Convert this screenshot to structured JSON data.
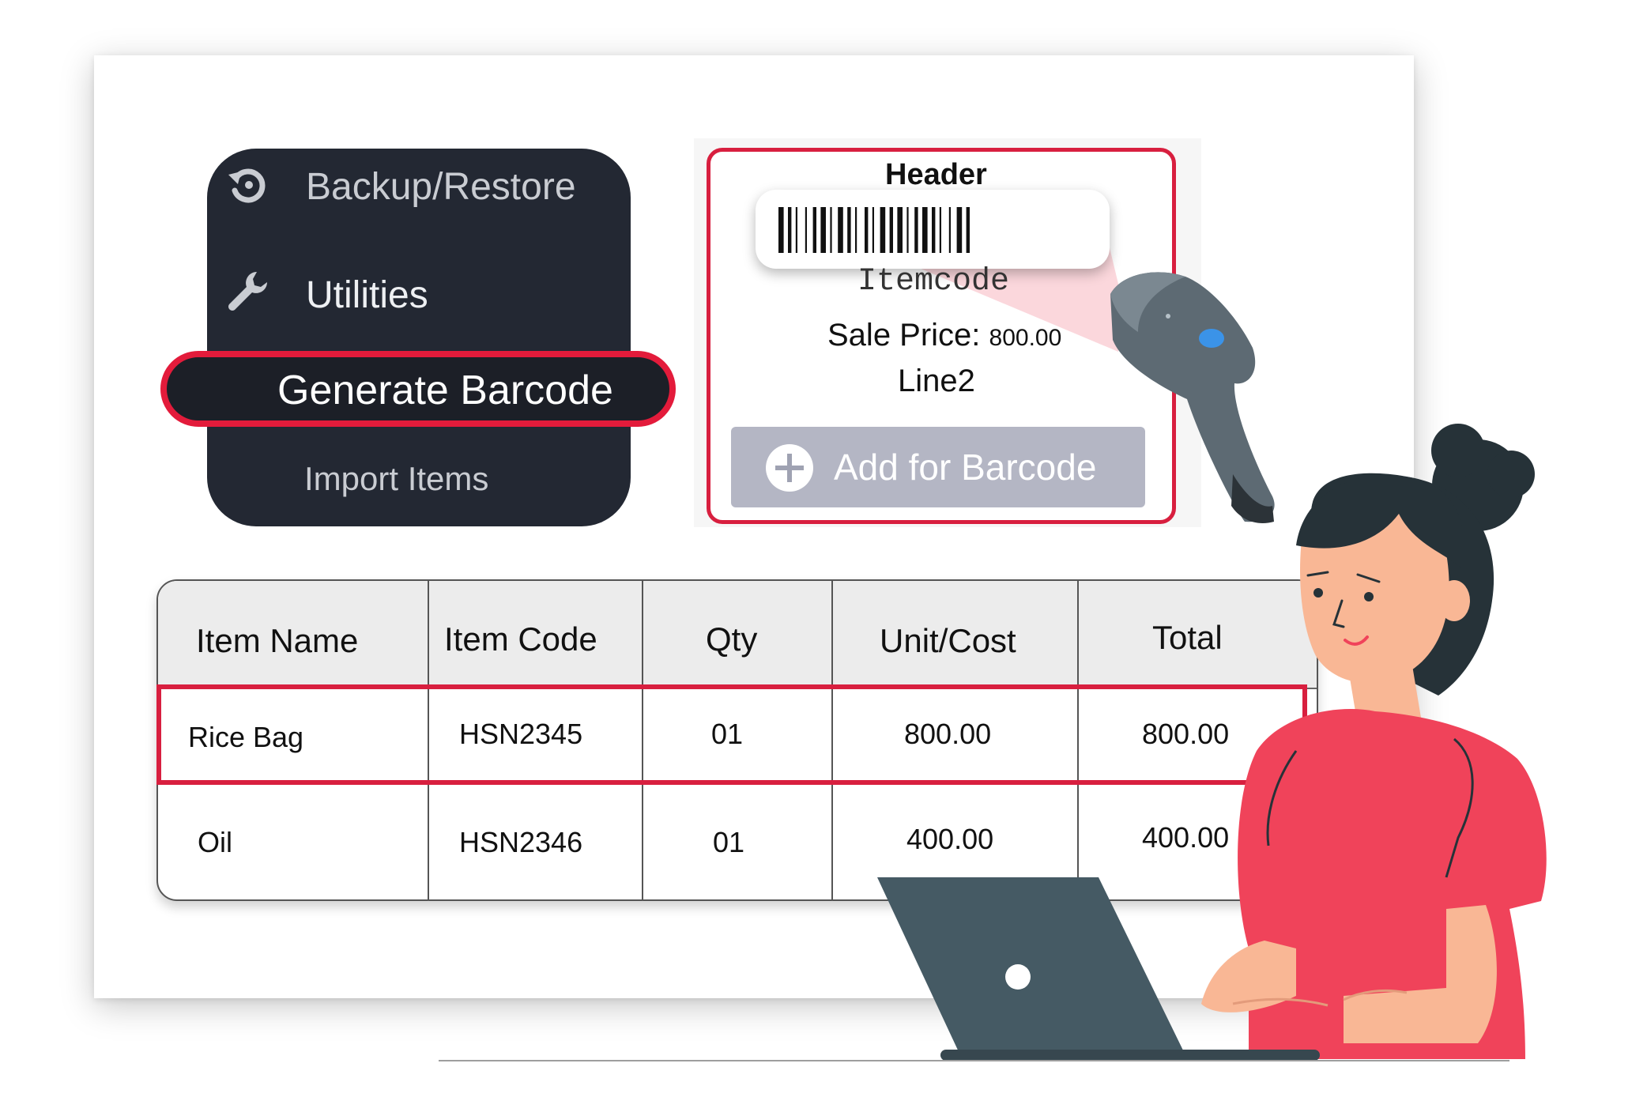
{
  "menu": {
    "items": [
      {
        "label": "Backup/Restore",
        "icon": "restore-icon"
      },
      {
        "label": "Utilities",
        "icon": "wrench-icon"
      },
      {
        "label": "Generate Barcode"
      },
      {
        "label": "Import Items"
      }
    ]
  },
  "label_preview": {
    "header": "Header",
    "itemcode": "Itemcode",
    "sale_price_label": "Sale Price:",
    "sale_price_value": "800.00",
    "line2": "Line2",
    "add_button": "Add for Barcode"
  },
  "table": {
    "headers": [
      "Item Name",
      "Item Code",
      "Qty",
      "Unit/Cost",
      "Total"
    ],
    "rows": [
      [
        "Rice Bag",
        "HSN2345",
        "01",
        "800.00",
        "800.00"
      ],
      [
        "Oil",
        "HSN2346",
        "01",
        "400.00",
        "400.00"
      ]
    ]
  },
  "colors": {
    "menu_bg": "#232833",
    "highlight": "#e31b3b",
    "button_bg": "#b4b6c4",
    "shirt": "#f0435a",
    "laptop": "#455a64"
  }
}
